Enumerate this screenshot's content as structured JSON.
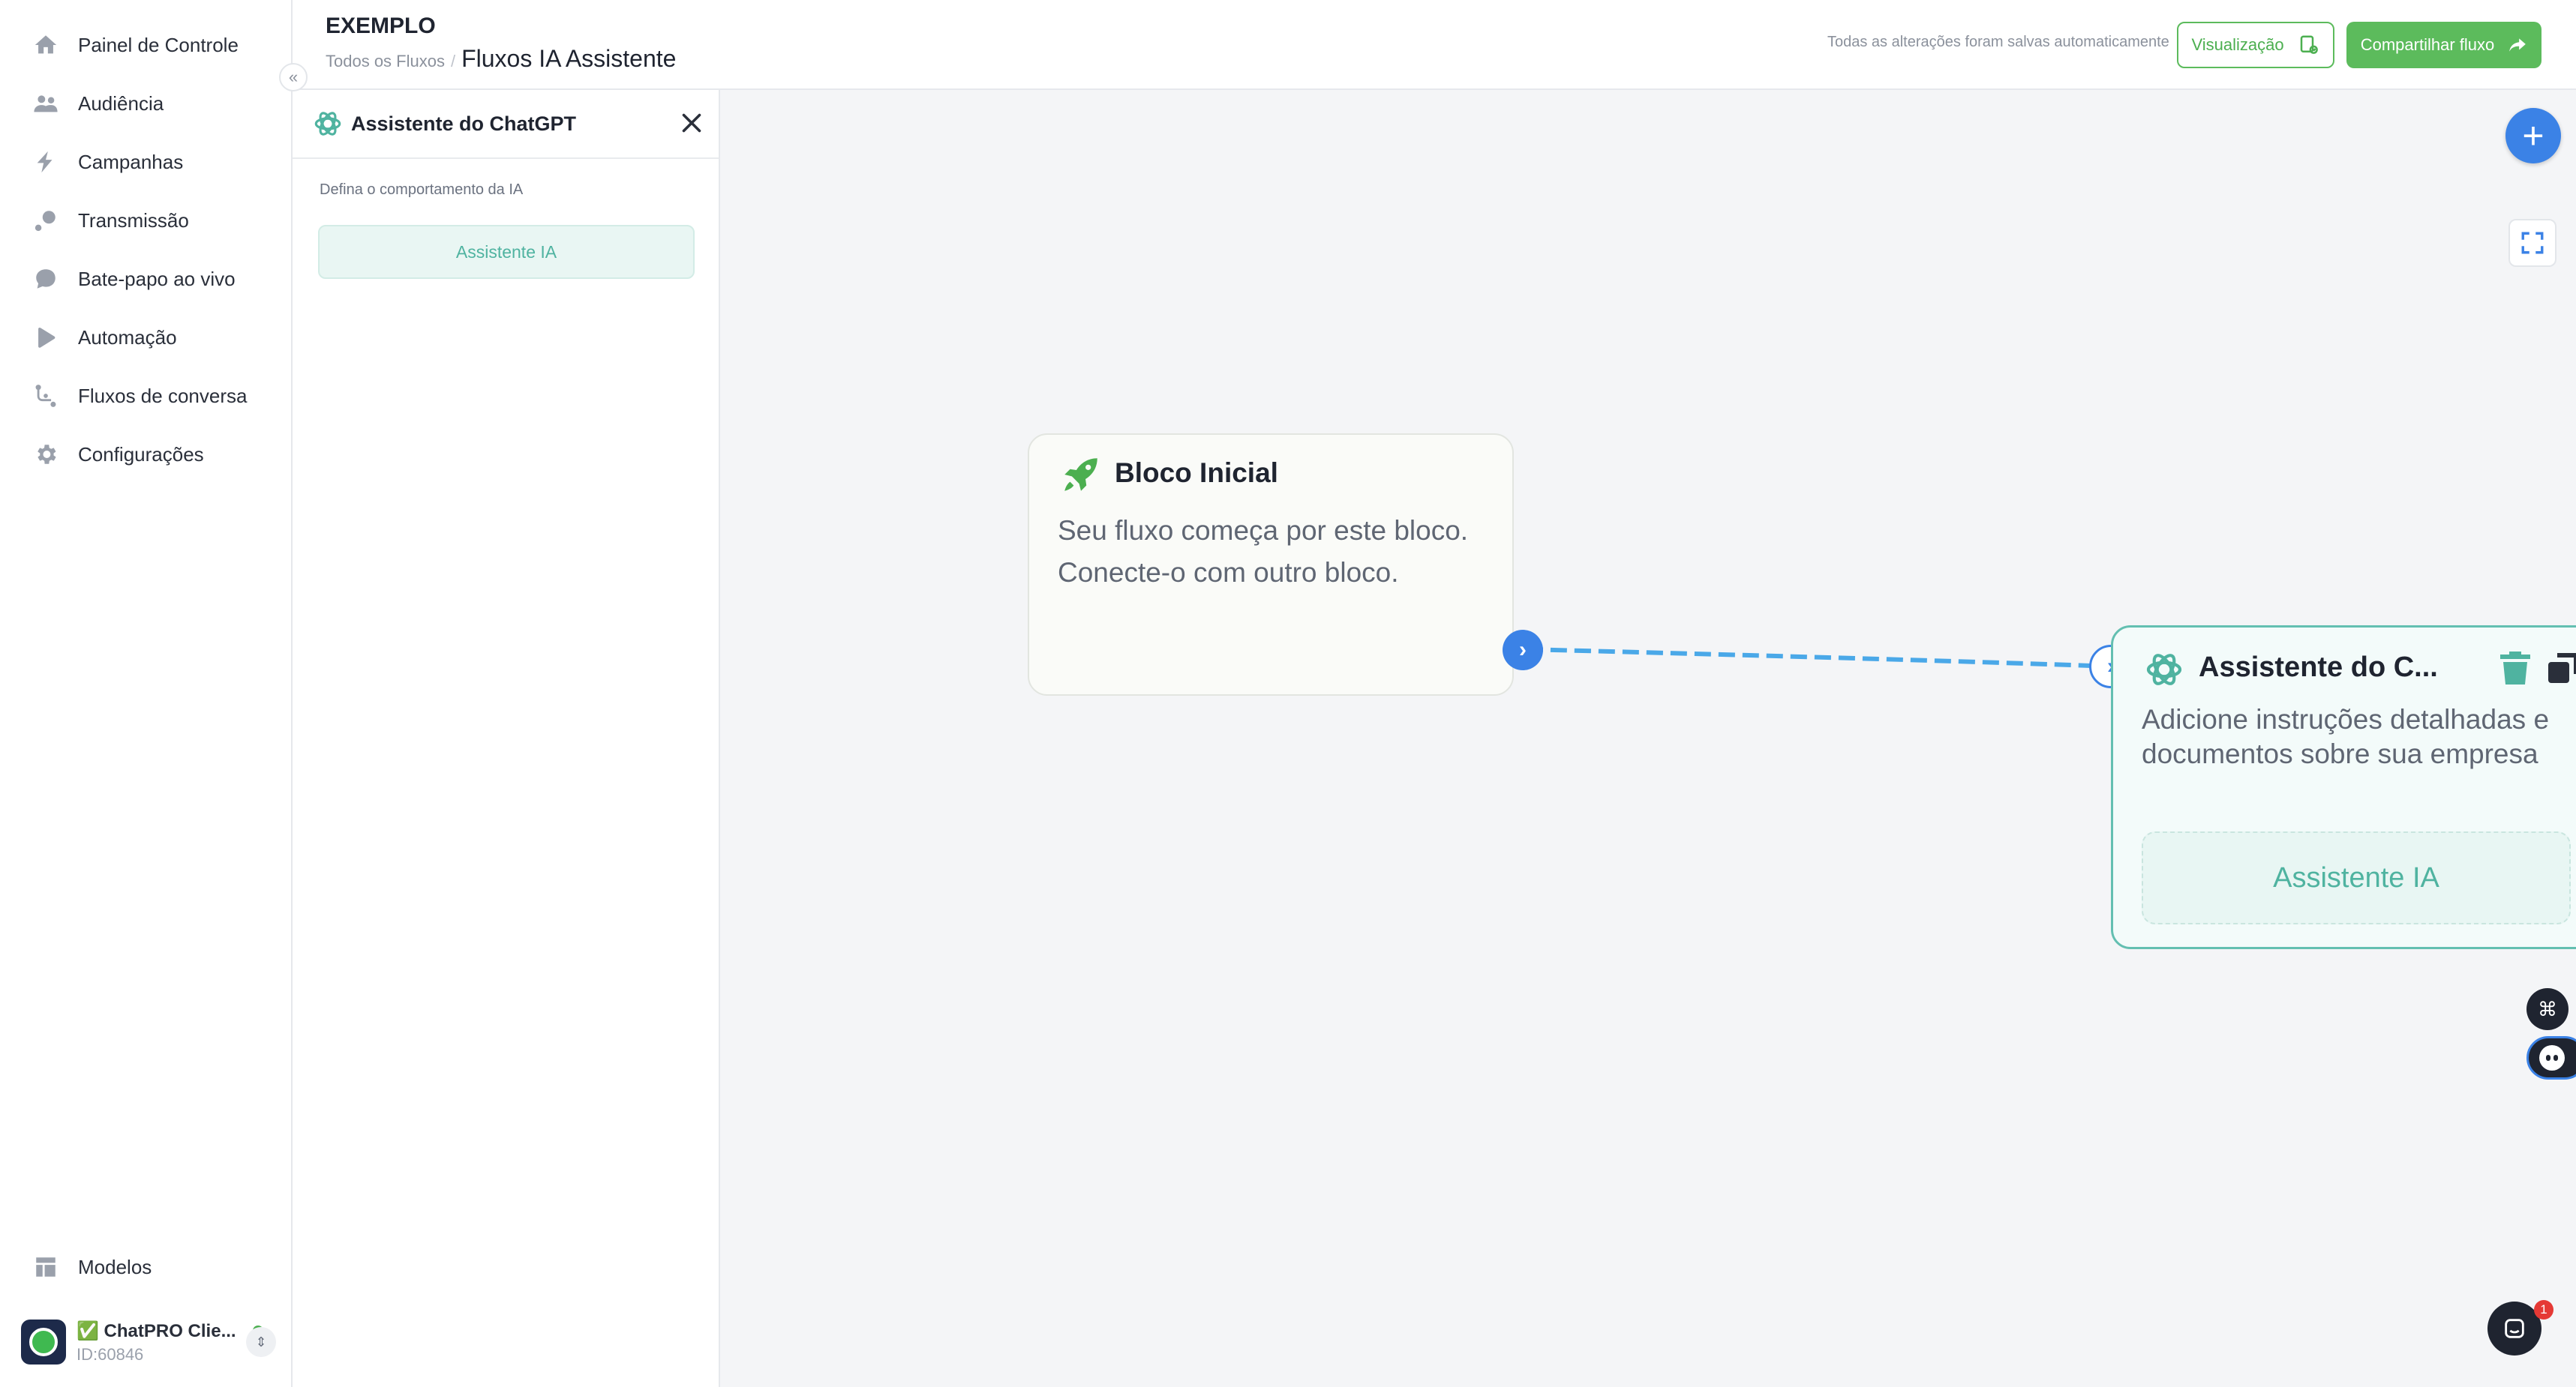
{
  "sidebar": {
    "items": [
      {
        "label": "Painel de Controle",
        "icon": "home-icon"
      },
      {
        "label": "Audiência",
        "icon": "users-icon"
      },
      {
        "label": "Campanhas",
        "icon": "bolt-icon"
      },
      {
        "label": "Transmissão",
        "icon": "broadcast-icon"
      },
      {
        "label": "Bate-papo ao vivo",
        "icon": "chat-bubble-icon"
      },
      {
        "label": "Automação",
        "icon": "play-icon"
      },
      {
        "label": "Fluxos de conversa",
        "icon": "flow-icon"
      },
      {
        "label": "Configurações",
        "icon": "gear-icon"
      }
    ],
    "templates_label": "Modelos",
    "collapse_icon": "«",
    "account": {
      "name": "✅ ChatPRO Clie...",
      "id": "ID:60846",
      "status_color": "#4caf50"
    }
  },
  "header": {
    "title": "EXEMPLO",
    "breadcrumb_link": "Todos os Fluxos",
    "breadcrumb_sep": "/",
    "breadcrumb_current": "Fluxos IA Assistente",
    "autosave_text": "Todas as alterações foram salvas automaticamente",
    "preview_label": "Visualização",
    "share_label": "Compartilhar fluxo",
    "accent_green": "#5cbb5c"
  },
  "panel": {
    "title": "Assistente do ChatGPT",
    "behavior_label": "Defina o comportamento da IA",
    "assistant_button": "Assistente IA"
  },
  "canvas": {
    "start_node": {
      "title": "Bloco Inicial",
      "description": "Seu fluxo começa por este bloco. Conecte-o com outro bloco."
    },
    "ai_node": {
      "title": "Assistente do C...",
      "description": "Adicione instruções detalhadas e documentos sobre sua empresa",
      "button": "Assistente IA"
    },
    "add_button": "+",
    "connector_color": "#4aa8e8",
    "chat_badge_count": "1"
  }
}
